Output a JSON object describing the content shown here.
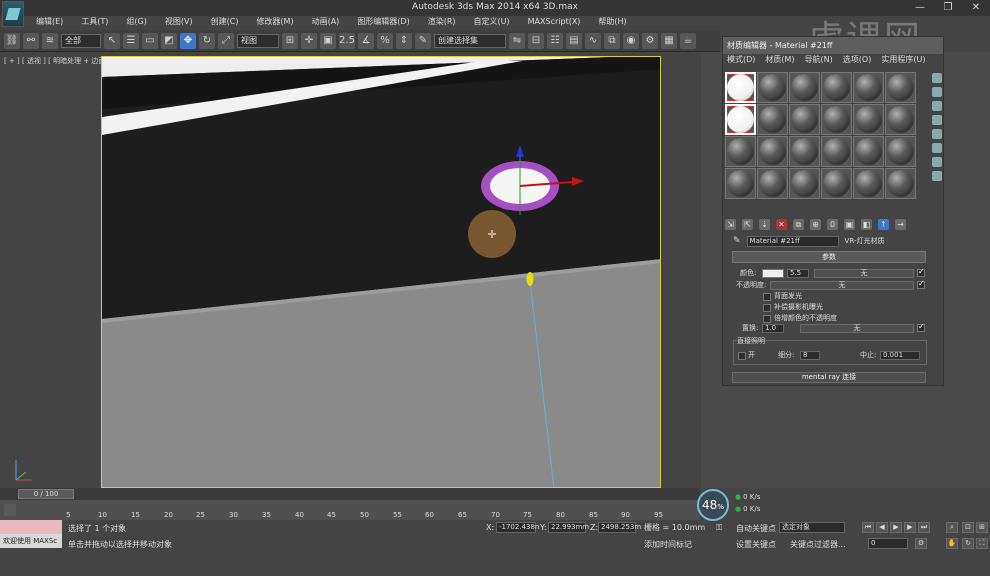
{
  "window": {
    "title": "Autodesk 3ds Max  2014 x64     3D.max",
    "minimize": "—",
    "restore": "❐",
    "close": "✕"
  },
  "menu": [
    "编辑(E)",
    "工具(T)",
    "组(G)",
    "视图(V)",
    "创建(C)",
    "修改器(M)",
    "动画(A)",
    "图形编辑器(D)",
    "渲染(R)",
    "自定义(U)",
    "MAXScript(X)",
    "帮助(H)"
  ],
  "toolbar": {
    "selection_filter": "全部",
    "reference_coord": "视图",
    "named_selection": "创建选择集",
    "snap_label": "2.5"
  },
  "viewport": {
    "label": "[ + ] [ 透视 ] [ 明暗处理 + 边面 ]"
  },
  "material_editor": {
    "title": "材质编辑器 - Material #21ff",
    "menu": [
      "模式(D)",
      "材质(M)",
      "导航(N)",
      "选项(O)",
      "实用程序(U)"
    ],
    "material_name": "Material #21ff",
    "material_type": "VR-灯光材质",
    "rollout_params": "参数",
    "color_label": "颜色:",
    "color_value": "5.5",
    "none": "无",
    "opacity_label": "不透明度:",
    "back_emit": "背面发光",
    "comp_camera": "补偿摄影机曝光",
    "multiply_opacity": "倍增颜色的不透明度",
    "displace_label": "置换:",
    "displace_value": "1.0",
    "direct_label": "直接照明",
    "direct_on": "开",
    "subdiv_label": "细分:",
    "subdiv_value": "8",
    "cutoff_label": "中止:",
    "cutoff_value": "0.001",
    "mentalray": "mental ray 连接"
  },
  "timeline": {
    "frame": "0 / 100",
    "ticks": [
      "5",
      "10",
      "15",
      "20",
      "25",
      "30",
      "35",
      "40",
      "45",
      "50",
      "55",
      "60",
      "65",
      "70",
      "75",
      "80",
      "85",
      "90",
      "95"
    ]
  },
  "status": {
    "maxscript": "欢迎使用 MAXSc",
    "selected": "选择了 1 个对象",
    "hint": "单击并拖动以选择并移动对象",
    "x_label": "X:",
    "x_value": "-1702.438n",
    "y_label": "Y:",
    "y_value": "22.993mm",
    "z_label": "Z:",
    "z_value": "2498.253m",
    "grid": "栅格 = 10.0mm",
    "add_time_tag": "添加时间标记",
    "auto_key": "自动关键点",
    "selected_obj": "选定对象",
    "set_key": "设置关键点",
    "key_filters": "关键点过滤器...",
    "frame_value": "0",
    "gauge": "48",
    "gauge_unit": "%",
    "net_up": "0 K/s",
    "net_down": "0 K/s"
  },
  "watermark": "虎课网"
}
